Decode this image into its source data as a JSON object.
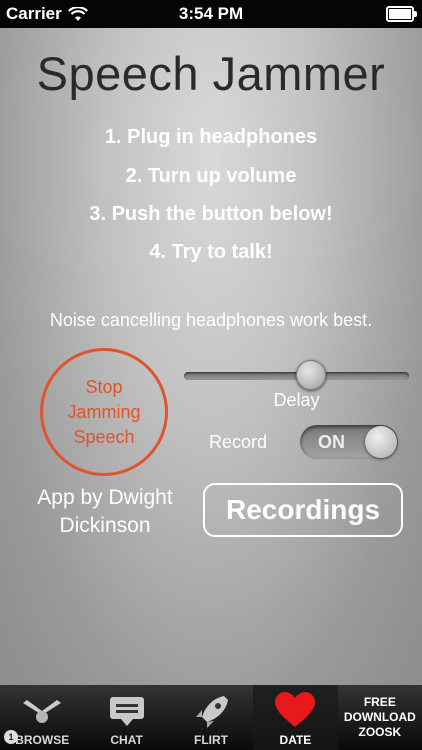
{
  "status_bar": {
    "carrier": "Carrier",
    "time": "3:54 PM"
  },
  "app": {
    "title": "Speech Jammer",
    "steps": [
      "1. Plug in headphones",
      "2. Turn up volume",
      "3. Push the button below!",
      "4. Try to talk!"
    ],
    "note": "Noise cancelling headphones work best.",
    "jam_button_lines": [
      "Stop",
      "Jamming",
      "Speech"
    ],
    "delay": {
      "label": "Delay",
      "value_fraction": 0.57
    },
    "record": {
      "label": "Record",
      "state_label": "ON"
    },
    "credit_lines": [
      "App by Dwight",
      "Dickinson"
    ],
    "recordings_button": "Recordings",
    "accent_color": "#e0532c"
  },
  "tab_bar": {
    "tabs": [
      {
        "label": "BROWSE",
        "icon": "browse-icon",
        "active": false
      },
      {
        "label": "CHAT",
        "icon": "chat-icon",
        "active": false
      },
      {
        "label": "FLIRT",
        "icon": "rocket-icon",
        "active": false
      },
      {
        "label": "DATE",
        "icon": "heart-icon",
        "active": true
      }
    ],
    "promo_lines": [
      "FREE",
      "DOWNLOAD",
      "ZOOSK"
    ]
  }
}
